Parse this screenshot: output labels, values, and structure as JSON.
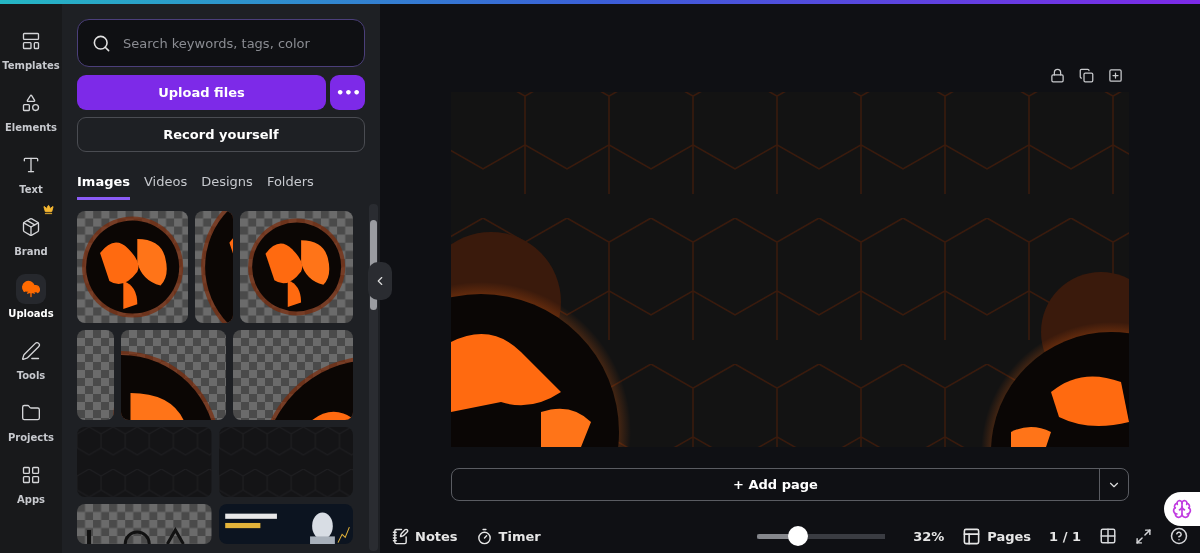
{
  "rail": [
    {
      "label": "Templates",
      "selected": false,
      "crown": false
    },
    {
      "label": "Elements",
      "selected": false,
      "crown": false
    },
    {
      "label": "Text",
      "selected": false,
      "crown": false
    },
    {
      "label": "Brand",
      "selected": false,
      "crown": true
    },
    {
      "label": "Uploads",
      "selected": true,
      "crown": false
    },
    {
      "label": "Tools",
      "selected": false,
      "crown": false
    },
    {
      "label": "Projects",
      "selected": false,
      "crown": false
    },
    {
      "label": "Apps",
      "selected": false,
      "crown": false
    }
  ],
  "search": {
    "placeholder": "Search keywords, tags, color"
  },
  "upload_button": "Upload files",
  "more_button": "•••",
  "record_button": "Record yourself",
  "tabs": [
    {
      "label": "Images",
      "selected": true
    },
    {
      "label": "Videos",
      "selected": false
    },
    {
      "label": "Designs",
      "selected": false
    },
    {
      "label": "Folders",
      "selected": false
    }
  ],
  "add_page": "+ Add page",
  "footer": {
    "notes": "Notes",
    "timer": "Timer",
    "zoom": {
      "level": 0.32,
      "reading": "32%"
    },
    "pages": "Pages",
    "page_count": "1 / 1"
  }
}
